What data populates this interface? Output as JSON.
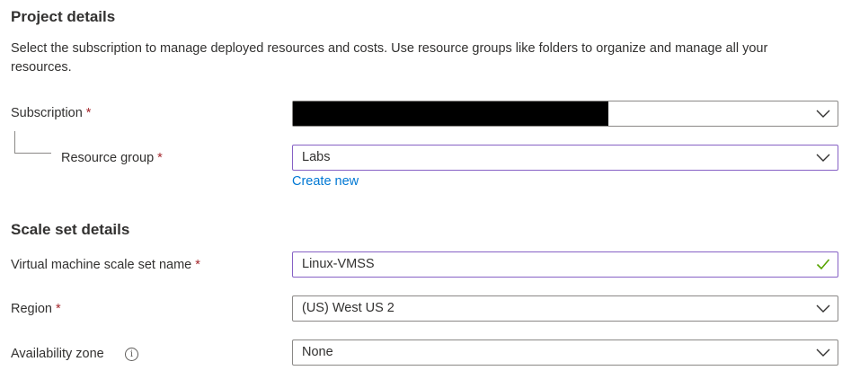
{
  "project": {
    "heading": "Project details",
    "description": "Select the subscription to manage deployed resources and costs. Use resource groups like folders to organize and manage all your resources.",
    "subscription": {
      "label": "Subscription",
      "required_mark": "*",
      "value": "",
      "value_redacted": true
    },
    "resource_group": {
      "label": "Resource group",
      "required_mark": "*",
      "value": "Labs",
      "create_new": "Create new"
    }
  },
  "scale_set": {
    "heading": "Scale set details",
    "name": {
      "label": "Virtual machine scale set name",
      "required_mark": "*",
      "value": "Linux-VMSS",
      "valid": true
    },
    "region": {
      "label": "Region",
      "required_mark": "*",
      "value": "(US) West US 2"
    },
    "availability_zone": {
      "label": "Availability zone",
      "info_icon": "i",
      "value": "None"
    }
  },
  "colors": {
    "text": "#323130",
    "required": "#a4262c",
    "link": "#0078d4",
    "active_border": "#8661c5",
    "valid_check": "#57a300",
    "border": "#8a8886"
  }
}
